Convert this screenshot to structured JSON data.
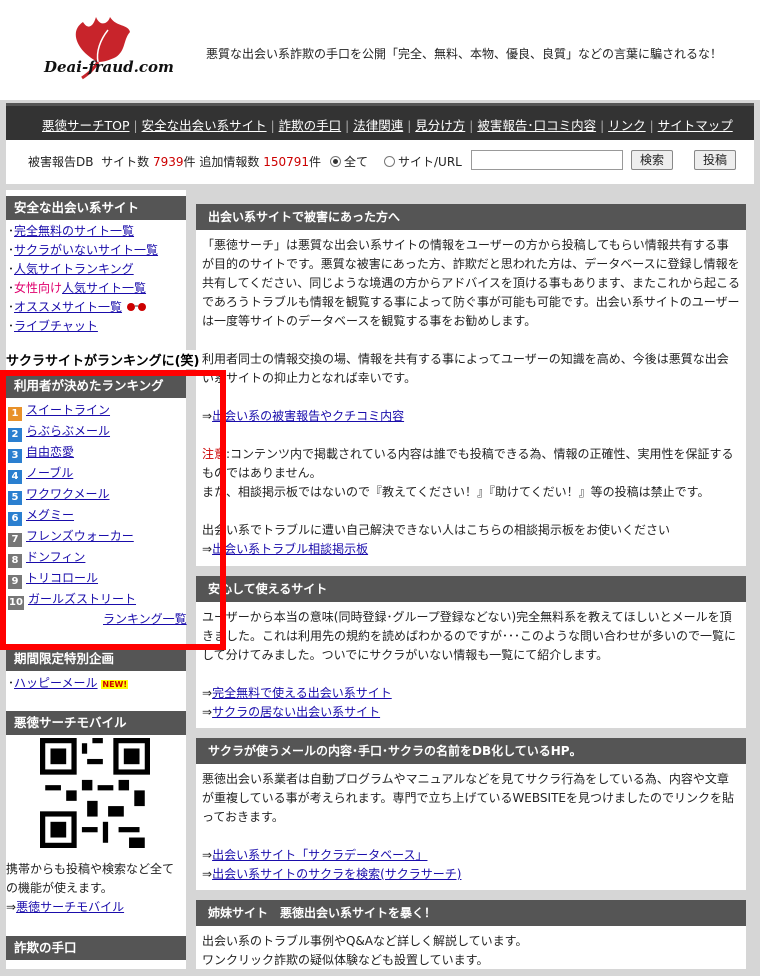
{
  "header": {
    "logo_text": "Deai-fraud.com",
    "tagline": "悪質な出会い系詐欺の手口を公開「完全、無料、本物、優良、良質」などの言葉に騙されるな！"
  },
  "nav": {
    "items": [
      "悪徳サーチTOP",
      "安全な出会い系サイト",
      "詐欺の手口",
      "法律関連",
      "見分け方",
      "被害報告･口コミ内容",
      "リンク",
      "サイトマップ"
    ]
  },
  "search": {
    "db_label": "被害報告DB",
    "site_count_label": "サイト数",
    "site_count": "7939",
    "count_unit": "件",
    "extra_label": "追加情報数",
    "extra_count": "150791",
    "radio_all": "全て",
    "radio_site": "サイト/URL",
    "search_button": "検索",
    "post_button": "投稿"
  },
  "sidebar": {
    "safe_title": "安全な出会い系サイト",
    "safe_items": [
      "完全無料のサイト一覧",
      "サクラがいないサイト一覧",
      "人気サイトランキング",
      "人気サイト一覧",
      "オススメサイト一覧",
      "ライブチャット"
    ],
    "women_prefix": "女性向け",
    "overlay_title": "サクラサイトがランキングに(笑)",
    "ranking_title": "利用者が決めたランキング",
    "ranking_items": [
      "スイートライン",
      "らぶらぶメール",
      "自由恋愛",
      "ノーブル",
      "ワクワクメール",
      "メグミー",
      "フレンズウォーカー",
      "ドンフィン",
      "トリコロール",
      "ガールズストリート"
    ],
    "ranking_more": "ランキング一覧",
    "limited_title": "期間限定特別企画",
    "limited_item": "ハッピーメール",
    "new_badge": "NEW!",
    "mobile_title": "悪徳サーチモバイル",
    "mobile_text": "携帯からも投稿や検索など全ての機能が使えます。",
    "mobile_link": "悪徳サーチモバイル",
    "fraud_title": "詐欺の手口"
  },
  "main": {
    "s1_title": "出会い系サイトで被害にあった方へ",
    "s1_p1": "「悪徳サーチ」は悪質な出会い系サイトの情報をユーザーの方から投稿してもらい情報共有する事が目的のサイトです。悪質な被害にあった方、詐欺だと思われた方は、データベースに登録し情報を共有してください、同じような境遇の方からアドバイスを頂ける事もあります、またこれから起こるであろうトラブルも情報を観覧する事によって防ぐ事が可能も可能です。出会い系サイトのユーザーは一度等サイトのデータベースを観覧する事をお勧めします。",
    "s1_p2": "利用者同士の情報交換の場、情報を共有する事によってユーザーの知識を高め、今後は悪質な出会い系サイトの抑止力となれば幸いです。",
    "s1_link1": "出会い系の被害報告やクチコミ内容",
    "s1_notice_label": "注意",
    "s1_notice": ":コンテンツ内で掲載されている内容は誰でも投稿できる為、情報の正確性、実用性を保証するものではありません。",
    "s1_notice2": "また、相談掲示板ではないので『教えてください！』『助けてくだい！』等の投稿は禁止です。",
    "s1_p3": "出会い系でトラブルに遭い自己解決できない人はこちらの相談掲示板をお使いください",
    "s1_link2": "出会い系トラブル相談掲示板",
    "s2_title": "安心して使えるサイト",
    "s2_p1": "ユーザーから本当の意味(同時登録･グループ登録などない)完全無料系を教えてほしいとメールを頂きました。これは利用先の規約を読めばわかるのですが･･･このような問い合わせが多いので一覧にして分けてみました。ついでにサクラがいない情報も一覧にて紹介します。",
    "s2_link1": "完全無料で使える出会い系サイト",
    "s2_link2": "サクラの居ない出会い系サイト",
    "s3_title": "サクラが使うメールの内容･手口･サクラの名前をDB化しているHP。",
    "s3_p1": "悪徳出会い系業者は自動プログラムやマニュアルなどを見てサクラ行為をしている為、内容や文章が重複している事が考えられます。専門で立ち上げているWEBSITEを見つけましたのでリンクを貼っておきます。",
    "s3_link1": "出会い系サイト「サクラデータベース」",
    "s3_link2": "出会い系サイトのサクラを検索(サクラサーチ)",
    "s4_title": "姉妹サイト　悪徳出会い系サイトを暴く！",
    "s4_p1": "出会い系のトラブル事例やQ&Aなど詳しく解説しています。",
    "s4_p2": "ワンクリック詐欺の疑似体験なども設置しています。"
  },
  "colors": {
    "accent_red": "#ff0000",
    "nav_bg": "#333333",
    "link": "#1a0dab"
  }
}
